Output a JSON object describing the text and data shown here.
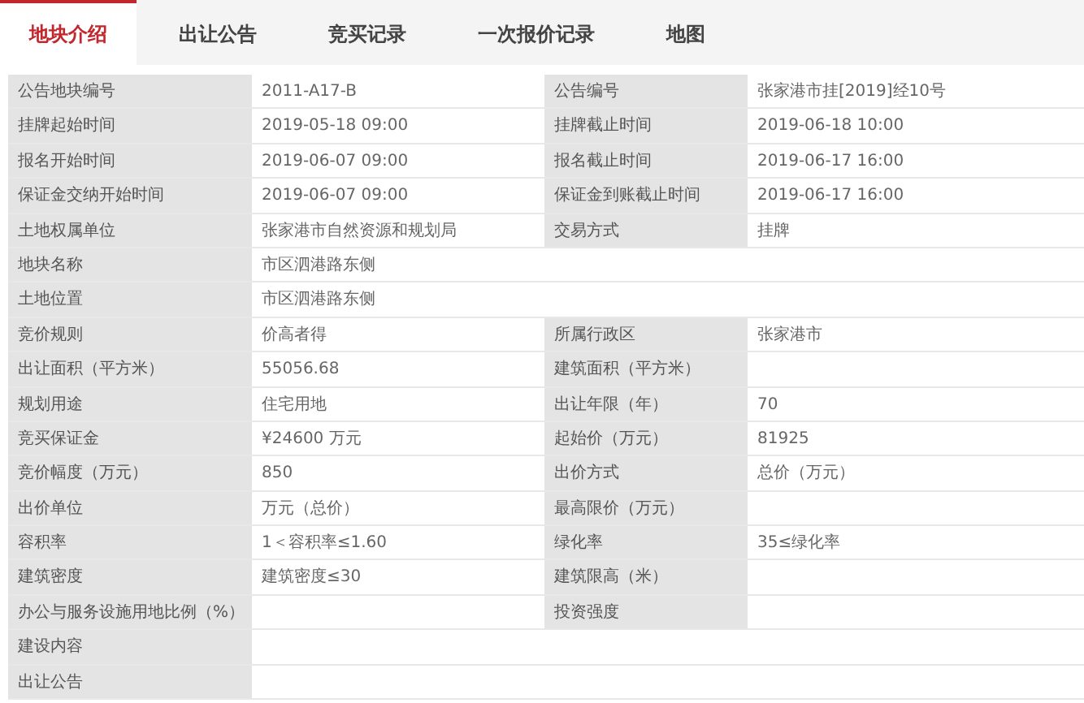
{
  "tabs": [
    {
      "label": "地块介绍",
      "selected": true
    },
    {
      "label": "出让公告",
      "selected": false
    },
    {
      "label": "竞买记录",
      "selected": false
    },
    {
      "label": "一次报价记录",
      "selected": false
    },
    {
      "label": "地图",
      "selected": false
    }
  ],
  "rows": [
    {
      "kind": "pair",
      "label": "公告地块编号",
      "value": "2011-A17-B",
      "label2": "公告编号",
      "value2": "张家港市挂[2019]经10号"
    },
    {
      "kind": "pair",
      "label": "挂牌起始时间",
      "value": "2019-05-18 09:00",
      "label2": "挂牌截止时间",
      "value2": "2019-06-18 10:00"
    },
    {
      "kind": "pair",
      "label": "报名开始时间",
      "value": "2019-06-07 09:00",
      "label2": "报名截止时间",
      "value2": "2019-06-17 16:00"
    },
    {
      "kind": "pair",
      "label": "保证金交纳开始时间",
      "value": "2019-06-07 09:00",
      "label2": "保证金到账截止时间",
      "value2": "2019-06-17 16:00"
    },
    {
      "kind": "pair",
      "label": "土地权属单位",
      "value": "张家港市自然资源和规划局",
      "label2": "交易方式",
      "value2": "挂牌"
    },
    {
      "kind": "full",
      "label": "地块名称",
      "value": "市区泗港路东侧"
    },
    {
      "kind": "full",
      "label": "土地位置",
      "value": "市区泗港路东侧"
    },
    {
      "kind": "pair",
      "label": "竞价规则",
      "value": "价高者得",
      "label2": "所属行政区",
      "value2": "张家港市"
    },
    {
      "kind": "pair",
      "label": "出让面积（平方米）",
      "value": "55056.68",
      "label2": "建筑面积（平方米）"
    },
    {
      "kind": "pair",
      "label": "规划用途",
      "value": "住宅用地",
      "label2": "出让年限（年）",
      "value2": "70"
    },
    {
      "kind": "pair",
      "label": "竞买保证金",
      "value": "¥24600 万元",
      "label2": "起始价（万元）",
      "value2": "81925"
    },
    {
      "kind": "pair",
      "label": "竞价幅度（万元）",
      "value": "850",
      "label2": "出价方式",
      "value2": "总价（万元）"
    },
    {
      "kind": "pair",
      "label": "出价单位",
      "value": "万元（总价）",
      "label2": "最高限价（万元）"
    },
    {
      "kind": "pair",
      "label": "容积率",
      "value": "1＜容积率≤1.60",
      "label2": "绿化率",
      "value2": "35≤绿化率"
    },
    {
      "kind": "pair",
      "label": "建筑密度",
      "value": "建筑密度≤30",
      "label2": "建筑限高（米）"
    },
    {
      "kind": "pair",
      "label": "办公与服务设施用地比例（%）",
      "label2": "投资强度"
    },
    {
      "kind": "full",
      "label": "建设内容"
    },
    {
      "kind": "full",
      "label": "出让公告"
    }
  ]
}
